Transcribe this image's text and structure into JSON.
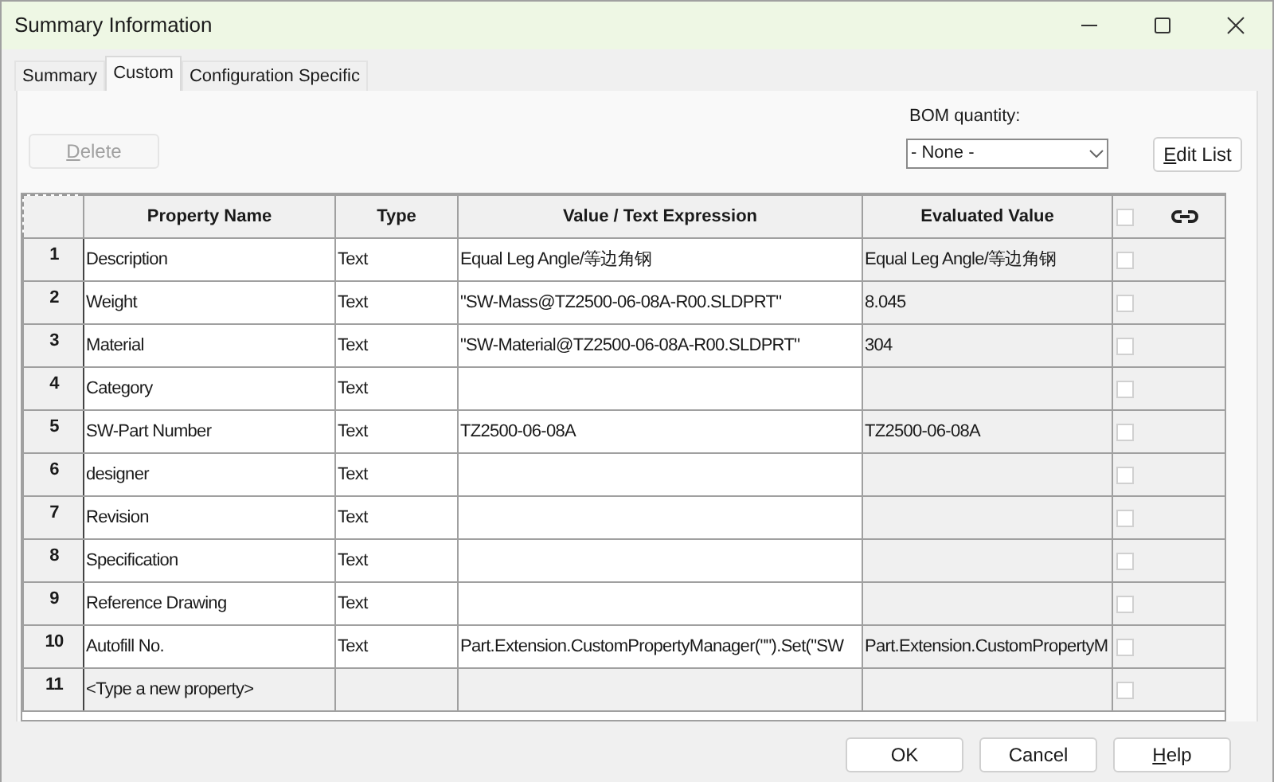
{
  "window": {
    "title": "Summary Information"
  },
  "tabs": [
    {
      "label": "Summary",
      "selected": false
    },
    {
      "label": "Custom",
      "selected": true
    },
    {
      "label": "Configuration Specific",
      "selected": false
    }
  ],
  "delete_button": {
    "label": "Delete",
    "disabled": true
  },
  "bom_quantity": {
    "label": "BOM quantity:",
    "value": "- None -"
  },
  "edit_list_button": {
    "label": "Edit List"
  },
  "table": {
    "columns": [
      "Property Name",
      "Type",
      "Value / Text Expression",
      "Evaluated Value"
    ],
    "header_checkbox": {
      "checked": false
    },
    "rows": [
      {
        "number": "1",
        "name": "Description",
        "type": "Text",
        "value": "Equal Leg Angle/等边角钢",
        "evaluated": "Equal Leg Angle/等边角钢",
        "checked": false,
        "new": false
      },
      {
        "number": "2",
        "name": "Weight",
        "type": "Text",
        "value": "\"SW-Mass@TZ2500-06-08A-R00.SLDPRT\"",
        "evaluated": "8.045",
        "checked": false,
        "new": false
      },
      {
        "number": "3",
        "name": "Material",
        "type": "Text",
        "value": "\"SW-Material@TZ2500-06-08A-R00.SLDPRT\"",
        "evaluated": "304",
        "checked": false,
        "new": false
      },
      {
        "number": "4",
        "name": "Category",
        "type": "Text",
        "value": "",
        "evaluated": "",
        "checked": false,
        "new": false
      },
      {
        "number": "5",
        "name": "SW-Part Number",
        "type": "Text",
        "value": "TZ2500-06-08A",
        "evaluated": "TZ2500-06-08A",
        "checked": false,
        "new": false
      },
      {
        "number": "6",
        "name": "designer",
        "type": "Text",
        "value": "",
        "evaluated": "",
        "checked": false,
        "new": false
      },
      {
        "number": "7",
        "name": "Revision",
        "type": "Text",
        "value": "",
        "evaluated": "",
        "checked": false,
        "new": false
      },
      {
        "number": "8",
        "name": "Specification",
        "type": "Text",
        "value": "",
        "evaluated": "",
        "checked": false,
        "new": false
      },
      {
        "number": "9",
        "name": "Reference Drawing",
        "type": "Text",
        "value": "",
        "evaluated": "",
        "checked": false,
        "new": false
      },
      {
        "number": "10",
        "name": "Autofill No.",
        "type": "Text",
        "value": "Part.Extension.CustomPropertyManager(\"\").Set(\"SW",
        "evaluated": "Part.Extension.CustomPropertyM",
        "checked": false,
        "new": false
      },
      {
        "number": "11",
        "name": "<Type a new property>",
        "type": "",
        "value": "",
        "evaluated": "",
        "checked": false,
        "new": true
      }
    ]
  },
  "buttons": [
    "OK",
    "Cancel",
    "Help"
  ]
}
